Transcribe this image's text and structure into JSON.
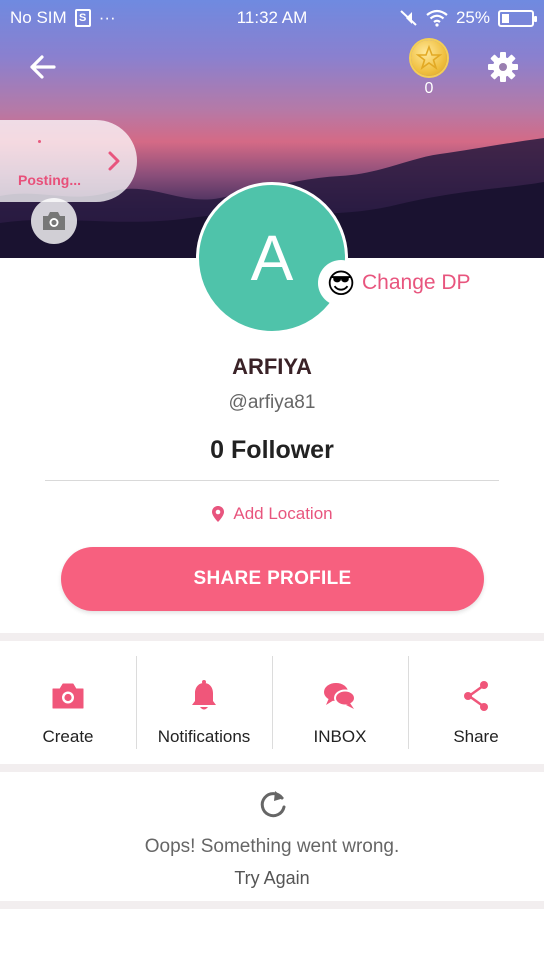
{
  "status_bar": {
    "carrier": "No SIM",
    "sim_icon": "S",
    "more": "···",
    "time": "11:32 AM",
    "battery_percent": "25%",
    "battery_level": 0.25
  },
  "header": {
    "coins": "0",
    "posting_label": "Posting..."
  },
  "profile": {
    "avatar_letter": "A",
    "avatar_color": "#4fc3aa",
    "change_dp_label": "Change DP",
    "name": "ARFIYA",
    "handle": "@arfiya81",
    "followers": "0 Follower",
    "add_location": "Add Location",
    "share_profile": "SHARE PROFILE"
  },
  "actions": [
    {
      "label": "Create",
      "icon": "camera-icon"
    },
    {
      "label": "Notifications",
      "icon": "bell-icon"
    },
    {
      "label": "INBOX",
      "icon": "chat-bubbles-icon"
    },
    {
      "label": "Share",
      "icon": "share-icon"
    }
  ],
  "feed_error": {
    "message": "Oops! Something went wrong.",
    "retry": "Try Again"
  },
  "colors": {
    "accent": "#f7607f",
    "accent_text": "#e8557e",
    "avatar_bg": "#4fc3aa"
  }
}
